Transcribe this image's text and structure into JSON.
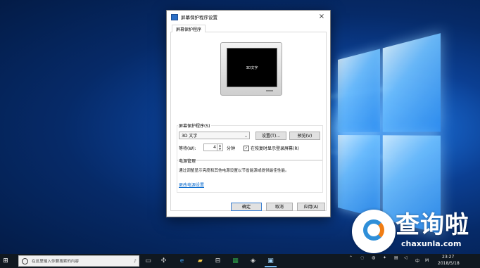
{
  "dialog": {
    "title": "屏幕保护程序设置",
    "close_glyph": "×",
    "tab_label": "屏幕保护程序",
    "preview_text": "3D文字",
    "screensaver_group_label": "屏幕保护程序(S)",
    "screensaver_selected": "3D 文字",
    "settings_button": "设置(T)...",
    "preview_button": "预览(V)",
    "wait_label": "等待(W):",
    "wait_value": "4",
    "wait_unit": "分钟",
    "resume_checkbox_label": "在恢复时显示登录屏幕(R)",
    "resume_checked": true,
    "power_group_label": "电源管理",
    "power_description": "通过调整显示亮度和其他电源设置以节省能源或提供最佳性能。",
    "power_link": "更改电源设置",
    "ok_button": "确定",
    "cancel_button": "取消",
    "apply_button": "应用(A)"
  },
  "taskbar": {
    "search_placeholder": "在这里输入你要搜索的内容",
    "time": "23:27",
    "date": "2018/5/18",
    "ime": "M",
    "ime_lang": "中",
    "icons": [
      "start-icon",
      "mic-icon",
      "task-view-icon",
      "fan-icon",
      "edge-icon",
      "folder-icon",
      "store-icon",
      "excel-icon",
      "media-icon",
      "screensaver-app-icon"
    ]
  },
  "watermark": {
    "brand": "查询啦",
    "url": "chaxunla.com"
  },
  "colors": {
    "accent": "#0066cc",
    "default_button_border": "#3b7fd1",
    "taskbar": "#101820"
  }
}
